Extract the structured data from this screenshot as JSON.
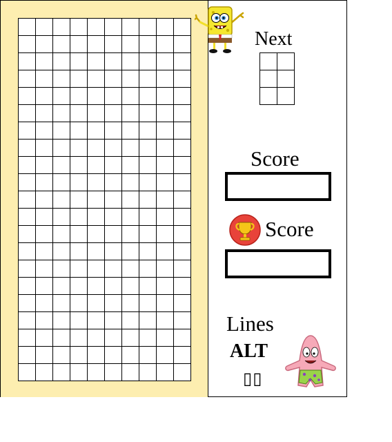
{
  "colors": {
    "panel_bg": "#fdeeb0",
    "cell_border": "#000000",
    "trophy_red": "#e8433a",
    "trophy_gold": "#f5c518"
  },
  "board": {
    "columns": 10,
    "rows": 21
  },
  "next_preview": {
    "label": "Next",
    "columns": 2,
    "rows": 3
  },
  "score": {
    "label": "Score",
    "value": ""
  },
  "high_score": {
    "icon": "trophy-icon",
    "label": "Score",
    "value": ""
  },
  "lines": {
    "label": "Lines",
    "mode": "ALT",
    "value": "▯▯"
  },
  "characters": [
    {
      "name": "spongebob",
      "icon": "spongebob-icon"
    },
    {
      "name": "patrick",
      "icon": "patrick-icon"
    }
  ]
}
